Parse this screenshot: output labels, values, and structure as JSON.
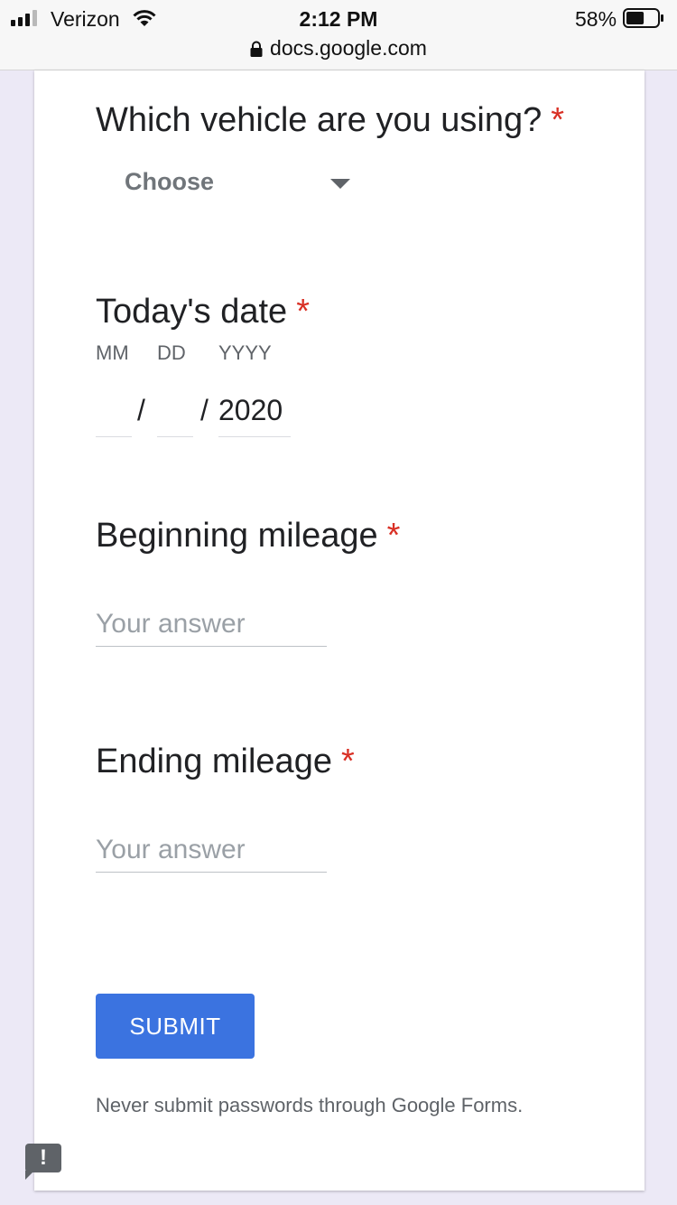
{
  "status_bar": {
    "carrier": "Verizon",
    "time": "2:12 PM",
    "battery_percent": "58%",
    "battery_level": 0.58,
    "url": "docs.google.com",
    "signal_icon": "signal-icon",
    "wifi_icon": "wifi-icon",
    "lock_icon": "lock-icon"
  },
  "form": {
    "vehicle": {
      "title": "Which vehicle are you using?",
      "required_mark": "*",
      "selected": "Choose"
    },
    "date": {
      "title": "Today's date",
      "required_mark": "*",
      "month_label": "MM",
      "day_label": "DD",
      "year_label": "YYYY",
      "month_value": "",
      "day_value": "",
      "year_value": "2020",
      "separator": "/"
    },
    "beginning_mileage": {
      "title": "Beginning mileage",
      "required_mark": "*",
      "placeholder": "Your answer"
    },
    "ending_mileage": {
      "title": "Ending mileage",
      "required_mark": "*",
      "placeholder": "Your answer"
    },
    "submit_label": "SUBMIT",
    "notice": "Never submit passwords through Google Forms."
  },
  "feedback_button": {
    "icon": "report-problem-icon",
    "glyph": "!"
  },
  "colors": {
    "required": "#d93025",
    "submit_button": "#3b73e0",
    "page_background": "#ece9f6",
    "card_background": "#ffffff"
  }
}
